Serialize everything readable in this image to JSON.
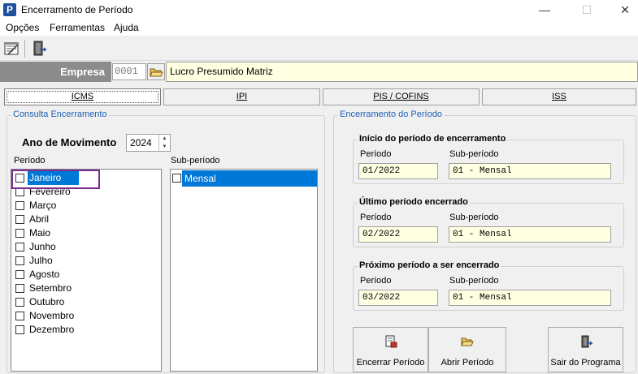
{
  "window": {
    "title": "Encerramento de Período",
    "minimize": "—",
    "maximize": "☐",
    "close": "✕"
  },
  "menu": [
    "Opções",
    "Ferramentas",
    "Ajuda"
  ],
  "toolbar": {
    "items": [
      {
        "icon": "notepad-icon"
      },
      {
        "icon": "exit-door-icon"
      }
    ]
  },
  "empresa": {
    "label": "Empresa",
    "code": "0001",
    "name": "Lucro Presumido Matriz"
  },
  "tabs": [
    {
      "label": "ICMS",
      "active": true
    },
    {
      "label": "IPI",
      "active": false
    },
    {
      "label": "PIS / COFINS",
      "active": false
    },
    {
      "label": "ISS",
      "active": false
    }
  ],
  "consulta": {
    "legend": "Consulta Encerramento",
    "ano_label": "Ano de Movimento",
    "ano_value": "2024",
    "periodo_label": "Período",
    "subperiodo_label": "Sub-período",
    "months": [
      "Janeiro",
      "Fevereiro",
      "Março",
      "Abril",
      "Maio",
      "Junho",
      "Julho",
      "Agosto",
      "Setembro",
      "Outubro",
      "Novembro",
      "Dezembro"
    ],
    "selected_month": "Janeiro",
    "subperiods": [
      "Mensal"
    ]
  },
  "encerramento": {
    "legend": "Encerramento do Período",
    "groups": [
      {
        "title": "Início do período de encerramento",
        "periodo_label": "Período",
        "sub_label": "Sub-período",
        "periodo": "01/2022",
        "sub": "01 - Mensal"
      },
      {
        "title": "Último período encerrado",
        "periodo_label": "Período",
        "sub_label": "Sub-período",
        "periodo": "02/2022",
        "sub": "01 - Mensal"
      },
      {
        "title": "Próximo período a ser encerrado",
        "periodo_label": "Período",
        "sub_label": "Sub-período",
        "periodo": "03/2022",
        "sub": "01 - Mensal"
      }
    ]
  },
  "buttons": {
    "encerrar": "Encerrar Período",
    "abrir": "Abrir Período",
    "sair": "Sair do Programa"
  }
}
